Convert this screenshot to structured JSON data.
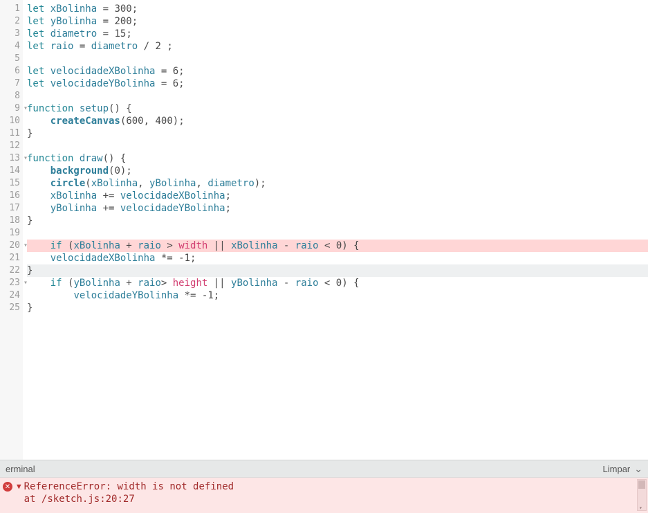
{
  "editor": {
    "gutter": [
      "1",
      "2",
      "3",
      "4",
      "5",
      "6",
      "7",
      "8",
      "9",
      "10",
      "11",
      "12",
      "13",
      "14",
      "15",
      "16",
      "17",
      "18",
      "19",
      "20",
      "21",
      "22",
      "23",
      "24",
      "25"
    ],
    "foldable_lines": [
      9,
      13,
      20,
      23
    ],
    "error_line": 20,
    "cursor_line": 22,
    "tokens": {
      "l1": [
        [
          "kw",
          "let "
        ],
        [
          "var",
          "xBolinha"
        ],
        [
          "op",
          " = "
        ],
        [
          "num",
          "300"
        ],
        [
          "op",
          ";"
        ]
      ],
      "l2": [
        [
          "kw",
          "let "
        ],
        [
          "var",
          "yBolinha"
        ],
        [
          "op",
          " = "
        ],
        [
          "num",
          "200"
        ],
        [
          "op",
          ";"
        ]
      ],
      "l3": [
        [
          "kw",
          "let "
        ],
        [
          "var",
          "diametro"
        ],
        [
          "op",
          " = "
        ],
        [
          "num",
          "15"
        ],
        [
          "op",
          ";"
        ]
      ],
      "l4": [
        [
          "kw",
          "let "
        ],
        [
          "var",
          "raio"
        ],
        [
          "op",
          " = "
        ],
        [
          "var",
          "diametro"
        ],
        [
          "op",
          " / "
        ],
        [
          "num",
          "2"
        ],
        [
          "op",
          " ;"
        ]
      ],
      "l5": [],
      "l6": [
        [
          "kw",
          "let "
        ],
        [
          "var",
          "velocidadeXBolinha"
        ],
        [
          "op",
          " = "
        ],
        [
          "num",
          "6"
        ],
        [
          "op",
          ";"
        ]
      ],
      "l7": [
        [
          "kw",
          "let "
        ],
        [
          "var",
          "velocidadeYBolinha"
        ],
        [
          "op",
          " = "
        ],
        [
          "num",
          "6"
        ],
        [
          "op",
          ";"
        ]
      ],
      "l8": [],
      "l9": [
        [
          "kw",
          "function "
        ],
        [
          "var",
          "setup"
        ],
        [
          "op",
          "() {"
        ]
      ],
      "l10": [
        [
          "op",
          "    "
        ],
        [
          "fn",
          "createCanvas"
        ],
        [
          "op",
          "("
        ],
        [
          "num",
          "600"
        ],
        [
          "op",
          ", "
        ],
        [
          "num",
          "400"
        ],
        [
          "op",
          ");"
        ]
      ],
      "l11": [
        [
          "op",
          "}"
        ]
      ],
      "l12": [],
      "l13": [
        [
          "kw",
          "function "
        ],
        [
          "var",
          "draw"
        ],
        [
          "op",
          "() {"
        ]
      ],
      "l14": [
        [
          "op",
          "    "
        ],
        [
          "fn",
          "background"
        ],
        [
          "op",
          "("
        ],
        [
          "num",
          "0"
        ],
        [
          "op",
          ");"
        ]
      ],
      "l15": [
        [
          "op",
          "    "
        ],
        [
          "fn",
          "circle"
        ],
        [
          "op",
          "("
        ],
        [
          "var",
          "xBolinha"
        ],
        [
          "op",
          ", "
        ],
        [
          "var",
          "yBolinha"
        ],
        [
          "op",
          ", "
        ],
        [
          "var",
          "diametro"
        ],
        [
          "op",
          ");"
        ]
      ],
      "l16": [
        [
          "op",
          "    "
        ],
        [
          "var",
          "xBolinha"
        ],
        [
          "op",
          " += "
        ],
        [
          "var",
          "velocidadeXBolinha"
        ],
        [
          "op",
          ";"
        ]
      ],
      "l17": [
        [
          "op",
          "    "
        ],
        [
          "var",
          "yBolinha"
        ],
        [
          "op",
          " += "
        ],
        [
          "var",
          "velocidadeYBolinha"
        ],
        [
          "op",
          ";"
        ]
      ],
      "l18": [
        [
          "op",
          "}"
        ]
      ],
      "l19": [],
      "l20": [
        [
          "op",
          "    "
        ],
        [
          "kw",
          "if"
        ],
        [
          "op",
          " ("
        ],
        [
          "var",
          "xBolinha"
        ],
        [
          "op",
          " + "
        ],
        [
          "var",
          "raio"
        ],
        [
          "op",
          " > "
        ],
        [
          "pink",
          "width"
        ],
        [
          "op",
          " || "
        ],
        [
          "var",
          "xBolinha"
        ],
        [
          "op",
          " - "
        ],
        [
          "var",
          "raio"
        ],
        [
          "op",
          " < "
        ],
        [
          "num",
          "0"
        ],
        [
          "op",
          ") {"
        ]
      ],
      "l21": [
        [
          "op",
          "    "
        ],
        [
          "var",
          "velocidadeXBolinha"
        ],
        [
          "op",
          " *= -"
        ],
        [
          "num",
          "1"
        ],
        [
          "op",
          ";"
        ]
      ],
      "l22": [
        [
          "op",
          "}"
        ]
      ],
      "l23": [
        [
          "op",
          "    "
        ],
        [
          "kw",
          "if"
        ],
        [
          "op",
          " ("
        ],
        [
          "var",
          "yBolinha"
        ],
        [
          "op",
          " + "
        ],
        [
          "var",
          "raio"
        ],
        [
          "op",
          "> "
        ],
        [
          "pink",
          "height"
        ],
        [
          "op",
          " || "
        ],
        [
          "var",
          "yBolinha"
        ],
        [
          "op",
          " - "
        ],
        [
          "var",
          "raio"
        ],
        [
          "op",
          " < "
        ],
        [
          "num",
          "0"
        ],
        [
          "op",
          ") {"
        ]
      ],
      "l24": [
        [
          "op",
          "        "
        ],
        [
          "var",
          "velocidadeYBolinha"
        ],
        [
          "op",
          " *= -"
        ],
        [
          "num",
          "1"
        ],
        [
          "op",
          ";"
        ]
      ],
      "l25": [
        [
          "op",
          "}"
        ]
      ]
    }
  },
  "panel": {
    "title": "erminal",
    "clear_label": "Limpar"
  },
  "console": {
    "error_title": "ReferenceError: width is not defined",
    "error_location": "    at /sketch.js:20:27"
  }
}
